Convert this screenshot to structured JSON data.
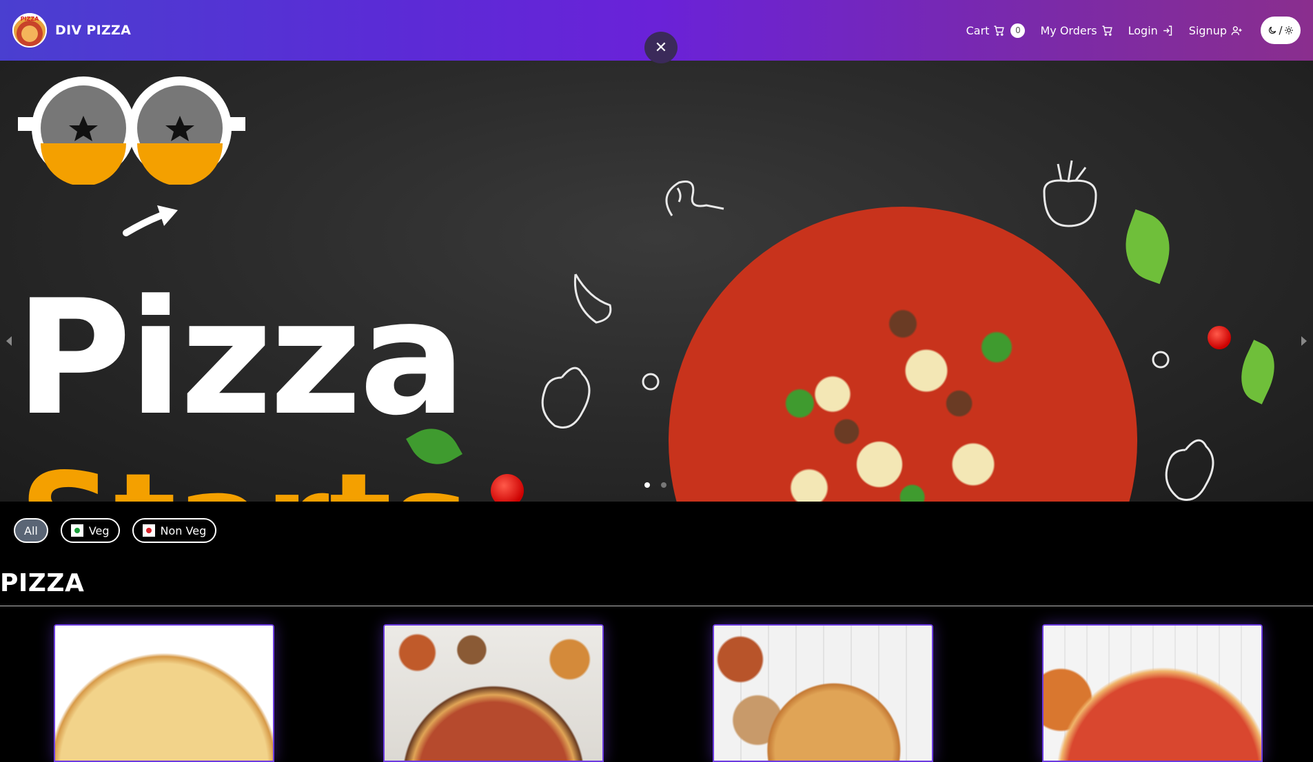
{
  "header": {
    "logo_text": "PIZZA",
    "brand": "DIV PIZZA",
    "cart_label": "Cart",
    "cart_count": "0",
    "orders_label": "My Orders",
    "login_label": "Login",
    "signup_label": "Signup",
    "theme_toggle_label": "/",
    "close_label": "✕"
  },
  "carousel": {
    "headline": "Pizza",
    "subheadline": "Starts",
    "slides": 2,
    "active_slide": 1
  },
  "filters": [
    {
      "label": "All",
      "active": true
    },
    {
      "label": "Veg",
      "active": false,
      "color": "#1a9e3a"
    },
    {
      "label": "Non Veg",
      "active": false,
      "color": "#d8222a"
    }
  ],
  "section": {
    "title": "PIZZA"
  },
  "colors": {
    "header_gradient_start": "#4a3fd0",
    "header_gradient_end": "#8a2e8e",
    "card_border": "#6b3be0",
    "background": "#000000"
  }
}
